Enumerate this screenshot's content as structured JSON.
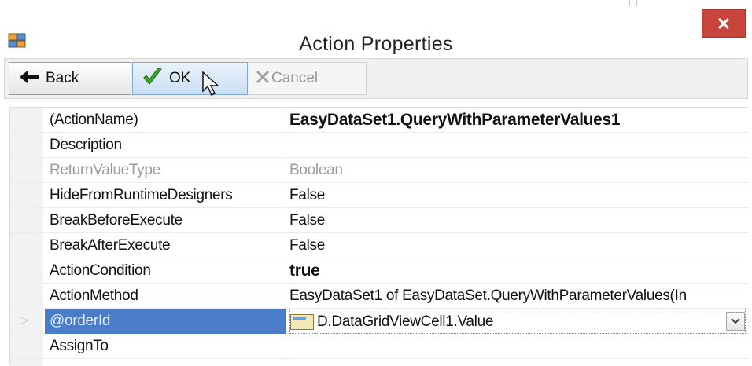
{
  "window": {
    "title": "Action Properties",
    "close_label": "✕",
    "icon": "app-window-icon"
  },
  "toolbar": {
    "back_label": "Back",
    "ok_label": "OK",
    "cancel_label": "Cancel",
    "icons": {
      "back": "back-arrow-icon",
      "ok": "checkmark-icon",
      "cancel": "cancel-x-icon"
    }
  },
  "properties": [
    {
      "name": "(ActionName)",
      "value": "EasyDataSet1.QueryWithParameterValues1",
      "bold": true,
      "dim": false
    },
    {
      "name": "Description",
      "value": "",
      "bold": false,
      "dim": false
    },
    {
      "name": "ReturnValueType",
      "value": "Boolean",
      "bold": false,
      "dim": true
    },
    {
      "name": "HideFromRuntimeDesigners",
      "value": "False",
      "bold": false,
      "dim": false
    },
    {
      "name": "BreakBeforeExecute",
      "value": "False",
      "bold": false,
      "dim": false
    },
    {
      "name": "BreakAfterExecute",
      "value": "False",
      "bold": false,
      "dim": false
    },
    {
      "name": "ActionCondition",
      "value": "true",
      "bold": true,
      "dim": false
    },
    {
      "name": "ActionMethod",
      "value": "EasyDataSet1 of EasyDataSet.QueryWithParameterValues(In",
      "bold": false,
      "dim": false
    },
    {
      "name": "@orderId",
      "value": "D.DataGridViewCell1.Value",
      "bold": false,
      "dim": false,
      "selected": true,
      "expandable": true
    },
    {
      "name": "AssignTo",
      "value": "",
      "bold": false,
      "dim": false
    }
  ],
  "colors": {
    "close_button": "#c9443a",
    "selection": "#4a7dc8"
  }
}
